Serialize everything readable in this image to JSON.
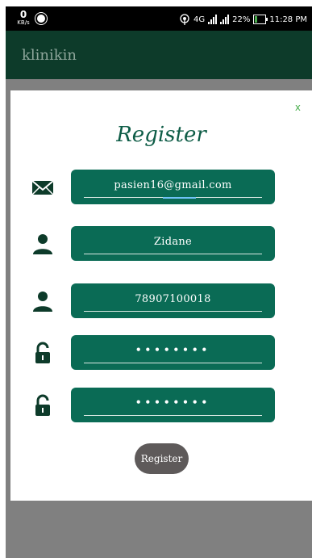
{
  "status_bar": {
    "speed_value": "0",
    "speed_unit": "KB/s",
    "network": "4G",
    "battery": "22%",
    "time": "11:28 PM"
  },
  "app_bar": {
    "title": "klinikin"
  },
  "dialog": {
    "close_label": "x",
    "title": "Register",
    "fields": [
      {
        "icon": "envelope-icon",
        "value": "pasien16@gmail.com"
      },
      {
        "icon": "person-icon",
        "value": "Zidane"
      },
      {
        "icon": "person-icon",
        "value": "78907100018"
      },
      {
        "icon": "lock-icon",
        "value": "••••••••"
      },
      {
        "icon": "lock-icon",
        "value": "••••••••"
      }
    ],
    "register_label": "Register"
  },
  "colors": {
    "app_bar": "#0d3b2a",
    "field_bg": "#0a6b55",
    "title": "#0d5c46",
    "button": "#5e5a5a",
    "close": "#4caf50",
    "backdrop": "#808080"
  }
}
